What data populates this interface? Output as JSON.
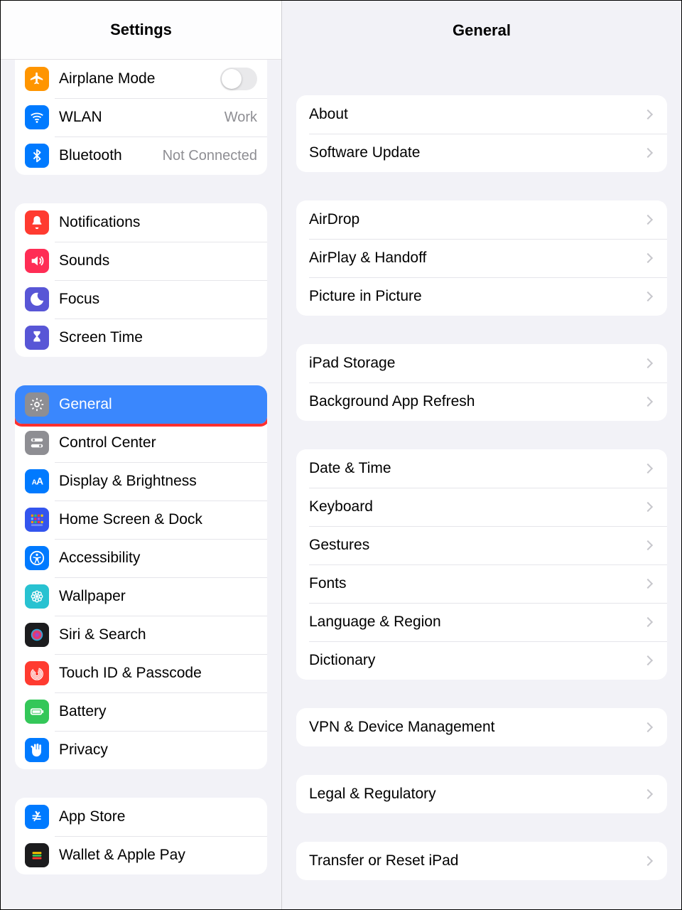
{
  "sidebar": {
    "title": "Settings",
    "groups": [
      {
        "id": "connectivity",
        "items": [
          {
            "icon": "airplane",
            "color": "#ff9500",
            "label": "Airplane Mode",
            "toggle": false
          },
          {
            "icon": "wifi",
            "color": "#007aff",
            "label": "WLAN",
            "value": "Work"
          },
          {
            "icon": "bluetooth",
            "color": "#007aff",
            "label": "Bluetooth",
            "value": "Not Connected"
          }
        ]
      },
      {
        "id": "notifications",
        "items": [
          {
            "icon": "bell",
            "color": "#ff3b30",
            "label": "Notifications"
          },
          {
            "icon": "speaker",
            "color": "#ff2d55",
            "label": "Sounds"
          },
          {
            "icon": "moon",
            "color": "#5856d6",
            "label": "Focus"
          },
          {
            "icon": "hourglass",
            "color": "#5856d6",
            "label": "Screen Time"
          }
        ]
      },
      {
        "id": "device",
        "items": [
          {
            "icon": "gear",
            "color": "#8e8e93",
            "label": "General",
            "selected": true,
            "highlighted": true
          },
          {
            "icon": "switches",
            "color": "#8e8e93",
            "label": "Control Center"
          },
          {
            "icon": "aa",
            "color": "#007aff",
            "label": "Display & Brightness"
          },
          {
            "icon": "grid",
            "color": "#3355ee",
            "label": "Home Screen & Dock"
          },
          {
            "icon": "accessibility",
            "color": "#007aff",
            "label": "Accessibility"
          },
          {
            "icon": "flower",
            "color": "#28c2d1",
            "label": "Wallpaper"
          },
          {
            "icon": "siri",
            "color": "#1c1c1e",
            "label": "Siri & Search"
          },
          {
            "icon": "fingerprint",
            "color": "#ff3b30",
            "label": "Touch ID & Passcode"
          },
          {
            "icon": "battery",
            "color": "#34c759",
            "label": "Battery"
          },
          {
            "icon": "hand",
            "color": "#007aff",
            "label": "Privacy"
          }
        ]
      },
      {
        "id": "store",
        "items": [
          {
            "icon": "appstore",
            "color": "#007aff",
            "label": "App Store"
          },
          {
            "icon": "wallet",
            "color": "#1c1c1e",
            "label": "Wallet & Apple Pay"
          }
        ]
      }
    ]
  },
  "main": {
    "title": "General",
    "groups": [
      {
        "items": [
          {
            "label": "About"
          },
          {
            "label": "Software Update"
          }
        ]
      },
      {
        "items": [
          {
            "label": "AirDrop"
          },
          {
            "label": "AirPlay & Handoff"
          },
          {
            "label": "Picture in Picture"
          }
        ]
      },
      {
        "items": [
          {
            "label": "iPad Storage"
          },
          {
            "label": "Background App Refresh"
          }
        ]
      },
      {
        "items": [
          {
            "label": "Date & Time"
          },
          {
            "label": "Keyboard"
          },
          {
            "label": "Gestures"
          },
          {
            "label": "Fonts"
          },
          {
            "label": "Language & Region"
          },
          {
            "label": "Dictionary"
          }
        ]
      },
      {
        "items": [
          {
            "label": "VPN & Device Management"
          }
        ]
      },
      {
        "items": [
          {
            "label": "Legal & Regulatory"
          }
        ]
      },
      {
        "items": [
          {
            "label": "Transfer or Reset iPad"
          }
        ]
      }
    ]
  }
}
